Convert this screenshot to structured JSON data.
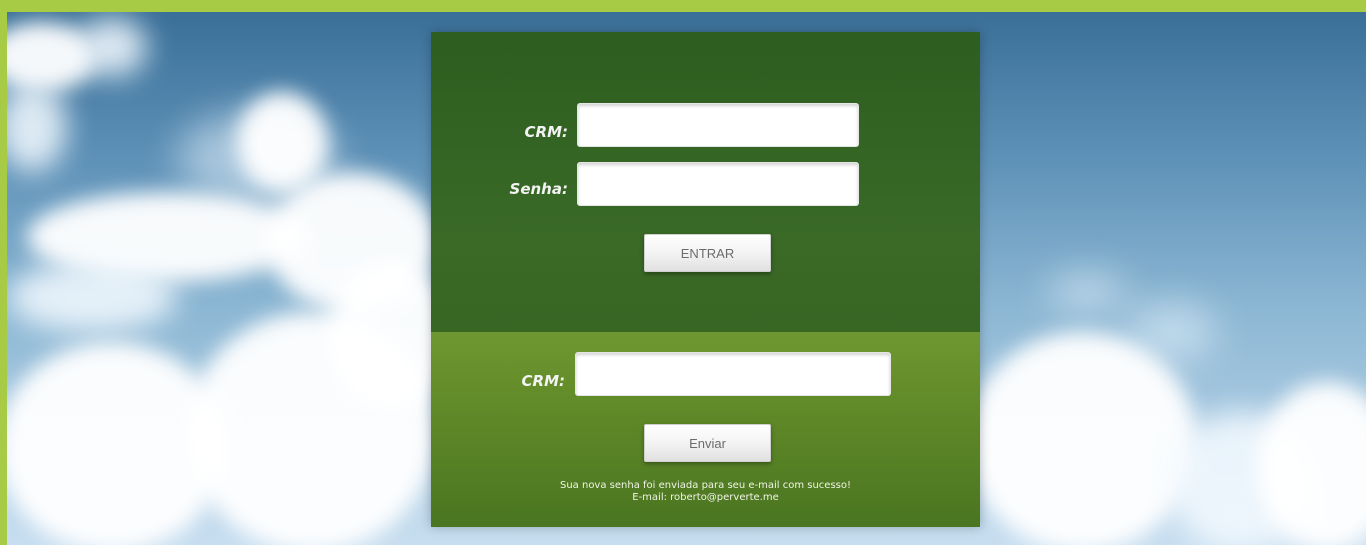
{
  "colors": {
    "page_border": "#a7cb45",
    "panel_top": "#3a6a26",
    "panel_bottom": "#5e8827",
    "label_text": "#f3f3f3"
  },
  "login": {
    "crm_label": "CRM:",
    "crm_value": "",
    "password_label": "Senha:",
    "password_value": "",
    "submit_label": "ENTRAR"
  },
  "recover": {
    "crm_label": "CRM:",
    "crm_value": "",
    "submit_label": "Enviar",
    "message_line1": "Sua nova senha foi enviada para seu e-mail com sucesso!",
    "message_line2": "E-mail: roberto@perverte.me"
  }
}
